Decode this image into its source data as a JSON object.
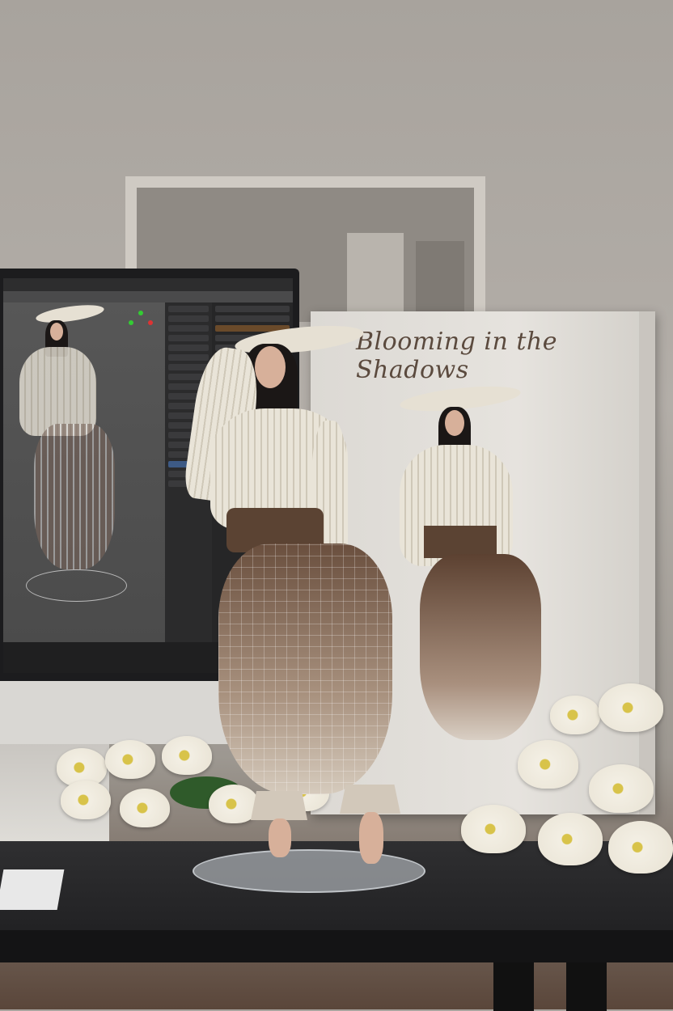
{
  "box": {
    "title": "Blooming in the Shadows"
  },
  "colors": {
    "wall": "#aaa59f",
    "box": "#e2dfda",
    "title": "#5b4a3e",
    "sash": "#5b4333",
    "desk": "#2a2a2c"
  }
}
